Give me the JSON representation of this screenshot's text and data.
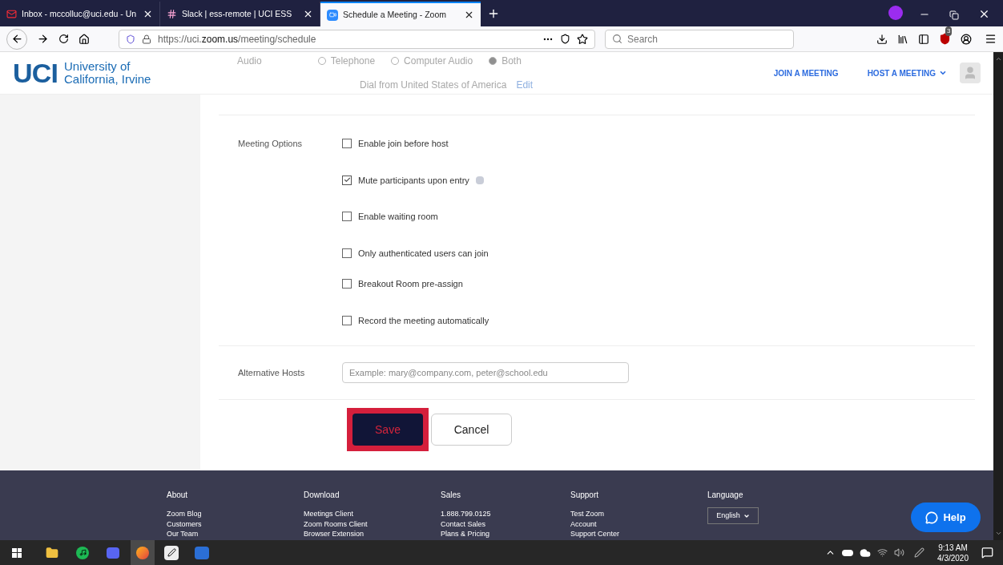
{
  "browser": {
    "tabs": [
      {
        "title": "Inbox - mccolluc@uci.edu - Un",
        "kind": "mail",
        "selected": false
      },
      {
        "title": "Slack | ess-remote | UCI ESS",
        "kind": "slack",
        "selected": false
      },
      {
        "title": "Schedule a Meeting - Zoom",
        "kind": "zoom",
        "selected": true
      }
    ],
    "url_prefix": "https://uci.",
    "url_domain": "zoom.us",
    "url_path": "/meeting/schedule",
    "search_placeholder": "Search",
    "extension_badge": "3"
  },
  "header": {
    "logo": "UCI",
    "logo_line1": "University of",
    "logo_line2": "California, Irvine",
    "nav": [
      "JOIN A MEETING",
      "HOST A MEETING"
    ]
  },
  "faded_audio": {
    "label": "Audio",
    "options": [
      {
        "label": "Telephone",
        "selected": false
      },
      {
        "label": "Computer Audio",
        "selected": false
      },
      {
        "label": "Both",
        "selected": true
      }
    ],
    "dial_text": "Dial from United States of America",
    "edit_link": "Edit"
  },
  "meeting_options": {
    "label": "Meeting Options",
    "options": [
      {
        "label": "Enable join before host",
        "checked": false,
        "info": false
      },
      {
        "label": "Mute participants upon entry",
        "checked": true,
        "info": true
      },
      {
        "label": "Enable waiting room",
        "checked": false,
        "info": false
      },
      {
        "label": "Only authenticated users can join",
        "checked": false,
        "info": false
      },
      {
        "label": "Breakout Room pre-assign",
        "checked": false,
        "info": false
      },
      {
        "label": "Record the meeting automatically",
        "checked": false,
        "info": false
      }
    ]
  },
  "alternative_hosts": {
    "label": "Alternative Hosts",
    "placeholder": "Example: mary@company.com, peter@school.edu"
  },
  "buttons": {
    "save": "Save",
    "cancel": "Cancel"
  },
  "footer": {
    "columns": [
      {
        "title": "About",
        "links": [
          "Zoom Blog",
          "Customers",
          "Our Team"
        ]
      },
      {
        "title": "Download",
        "links": [
          "Meetings Client",
          "Zoom Rooms Client",
          "Browser Extension"
        ]
      },
      {
        "title": "Sales",
        "links": [
          "1.888.799.0125",
          "Contact Sales",
          "Plans & Pricing"
        ]
      },
      {
        "title": "Support",
        "links": [
          "Test Zoom",
          "Account",
          "Support Center"
        ]
      }
    ],
    "language_title": "Language",
    "language": "English",
    "help": "Help"
  },
  "taskbar": {
    "time": "9:13 AM",
    "date": "4/3/2020"
  }
}
